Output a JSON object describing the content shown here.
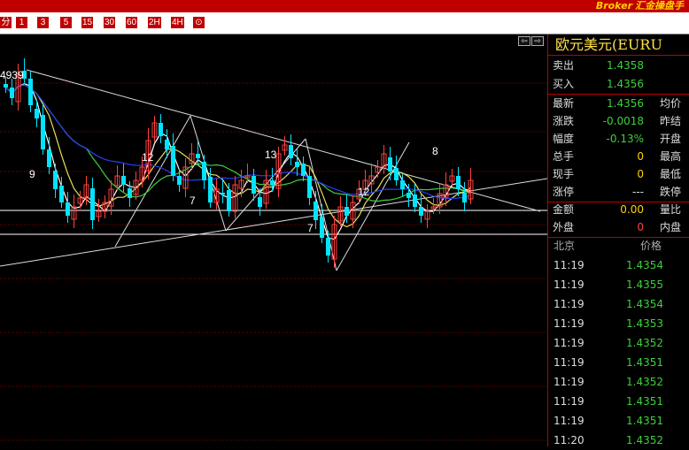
{
  "header": {
    "brand_small": "Broker",
    "brand_main": "汇金操盘手"
  },
  "toolbar": {
    "buttons": [
      {
        "label": "分"
      },
      {
        "label": "1"
      },
      {
        "label": "3"
      },
      {
        "label": "5"
      },
      {
        "label": "15"
      },
      {
        "label": "30"
      },
      {
        "label": "60"
      },
      {
        "label": "2H"
      },
      {
        "label": "4H"
      },
      {
        "label": "⊙"
      }
    ]
  },
  "chart": {
    "price_label": "4939",
    "wave_labels": [
      "9",
      "12",
      "7",
      "13",
      "7",
      "12",
      "8"
    ],
    "nav": [
      "⇦",
      "⇨"
    ]
  },
  "quote": {
    "title": "欧元美元(EURU",
    "sell": {
      "label": "卖出",
      "value": "1.4358"
    },
    "buy": {
      "label": "买入",
      "value": "1.4356"
    },
    "stats": [
      {
        "label": "最新",
        "value": "1.4356",
        "right": "均价"
      },
      {
        "label": "涨跌",
        "value": "-0.0018",
        "right": "昨结"
      },
      {
        "label": "幅度",
        "value": "-0.13%",
        "right": "开盘"
      },
      {
        "label": "总手",
        "value": "0",
        "right": "最高"
      },
      {
        "label": "现手",
        "value": "0",
        "right": "最低"
      },
      {
        "label": "涨停",
        "value": "---",
        "right": "跌停"
      },
      {
        "label": "金额",
        "value": "0.00",
        "right": "量比"
      },
      {
        "label": "外盘",
        "value": "0",
        "right": "内盘"
      }
    ]
  },
  "ticks": {
    "headers": [
      "北京",
      "价格"
    ],
    "rows": [
      {
        "time": "11:19",
        "price": "1.4354"
      },
      {
        "time": "11:19",
        "price": "1.4355"
      },
      {
        "time": "11:19",
        "price": "1.4354"
      },
      {
        "time": "11:19",
        "price": "1.4353"
      },
      {
        "time": "11:19",
        "price": "1.4352"
      },
      {
        "time": "11:19",
        "price": "1.4351"
      },
      {
        "time": "11:19",
        "price": "1.4352"
      },
      {
        "time": "11:19",
        "price": "1.4351"
      },
      {
        "time": "11:19",
        "price": "1.4351"
      },
      {
        "time": "11:20",
        "price": "1.4352"
      }
    ]
  },
  "colors": {
    "up": "#ff4040",
    "down": "#00e5ff",
    "grid": "#8b0000",
    "ma1": "#ffffff",
    "ma2": "#e8e05a",
    "ma3": "#3ecf3e",
    "ma4": "#2a3cff"
  }
}
